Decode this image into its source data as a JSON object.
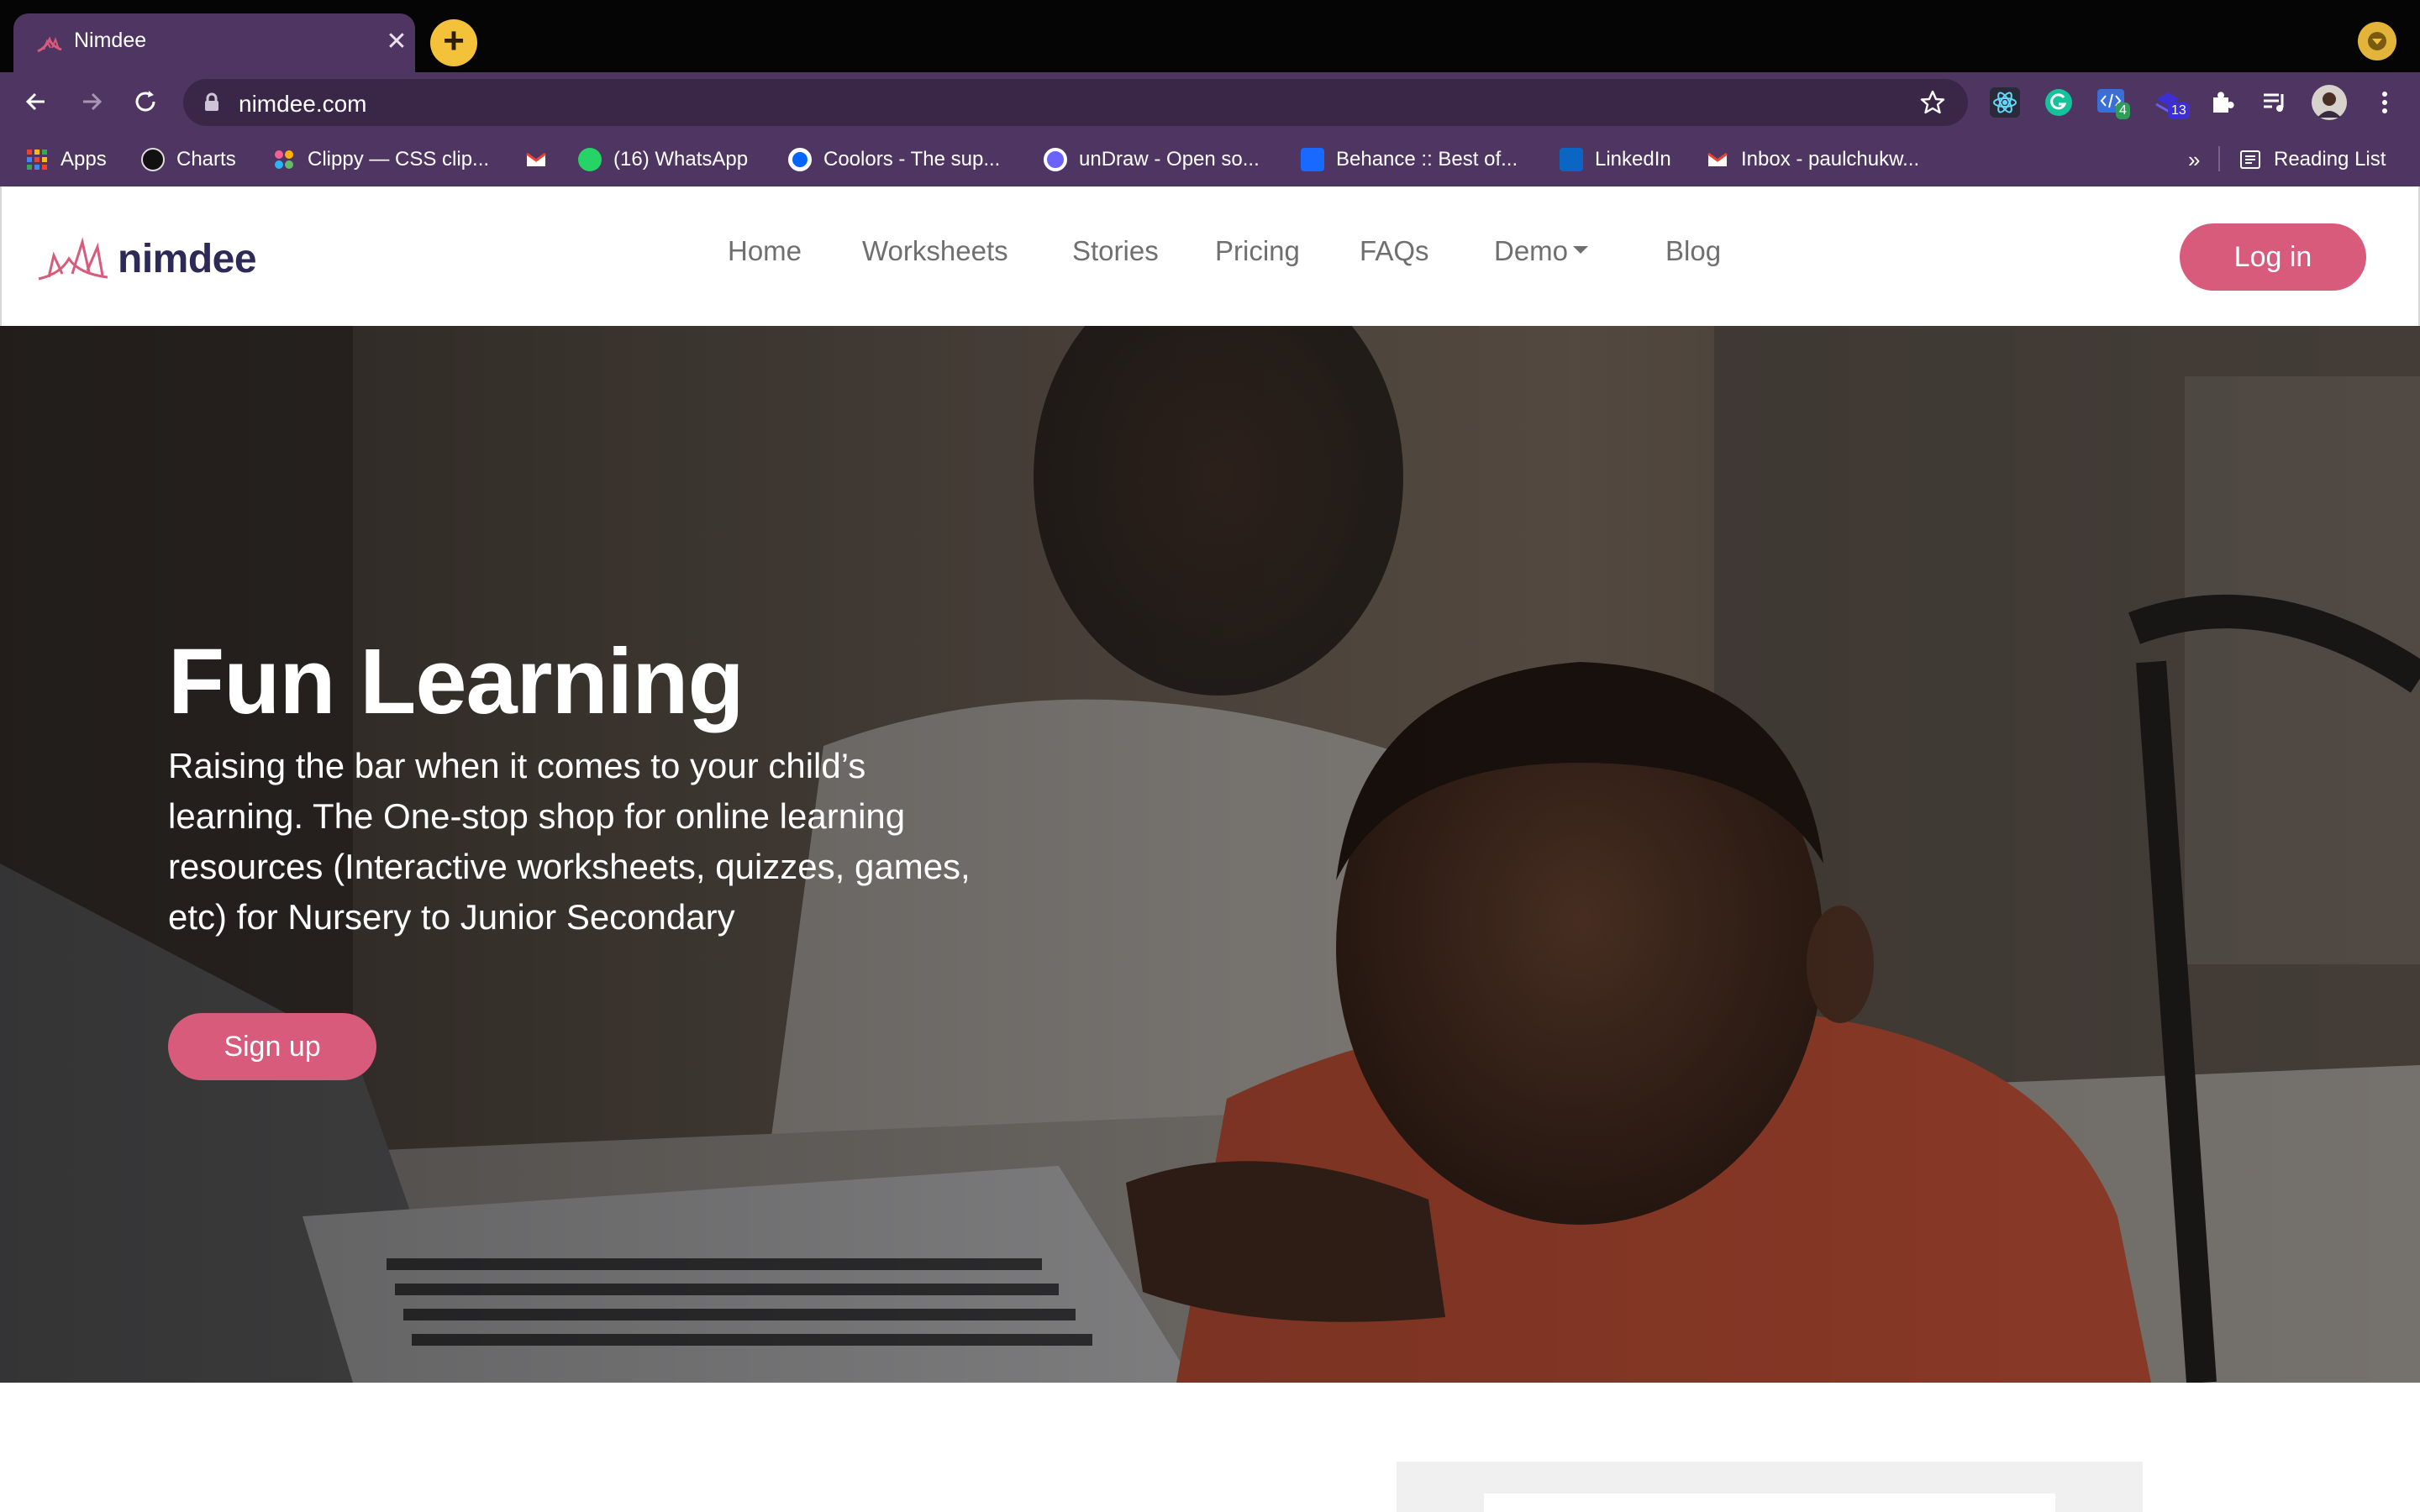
{
  "browser": {
    "tab": {
      "title": "Nimdee",
      "close_glyph": "✕",
      "favicon": "nimdee-logo-icon"
    },
    "new_tab_glyph": "+",
    "address_bar": {
      "url": "nimdee.com"
    },
    "bookmarks": [
      {
        "label": "Apps",
        "icon": "apps-grid-icon"
      },
      {
        "label": "Charts",
        "icon": "charts-favicon"
      },
      {
        "label": "Clippy — CSS clip...",
        "icon": "clippy-favicon"
      },
      {
        "label": "",
        "icon": "gmail-icon"
      },
      {
        "label": "(16) WhatsApp",
        "icon": "whatsapp-icon"
      },
      {
        "label": "Coolors - The sup...",
        "icon": "coolors-favicon"
      },
      {
        "label": "unDraw - Open so...",
        "icon": "undraw-favicon"
      },
      {
        "label": "Behance :: Best of...",
        "icon": "behance-icon"
      },
      {
        "label": "LinkedIn",
        "icon": "linkedin-icon"
      },
      {
        "label": "Inbox - paulchukw...",
        "icon": "gmail-icon"
      }
    ],
    "bookmarks_overflow": "»",
    "reading_list": "Reading List",
    "extension_badges": {
      "devtools": "4",
      "other": "13"
    }
  },
  "site": {
    "logo_text": "nimdee",
    "nav": [
      {
        "label": "Home"
      },
      {
        "label": "Worksheets"
      },
      {
        "label": "Stories"
      },
      {
        "label": "Pricing"
      },
      {
        "label": "FAQs"
      },
      {
        "label": "Demo"
      },
      {
        "label": "Blog"
      }
    ],
    "login_label": "Log in",
    "colors": {
      "brand_pink": "#d85b7c",
      "brand_navy": "#2e2a57",
      "browser_purple": "#4f3561"
    }
  },
  "hero": {
    "title": "Fun Learning",
    "subtitle": "Raising the bar when it comes to your child’s learning. The One-stop shop for online learning resources (Interactive worksheets, quizzes, games, etc) for Nursery to Junior Secondary",
    "signup_label": "Sign up"
  }
}
